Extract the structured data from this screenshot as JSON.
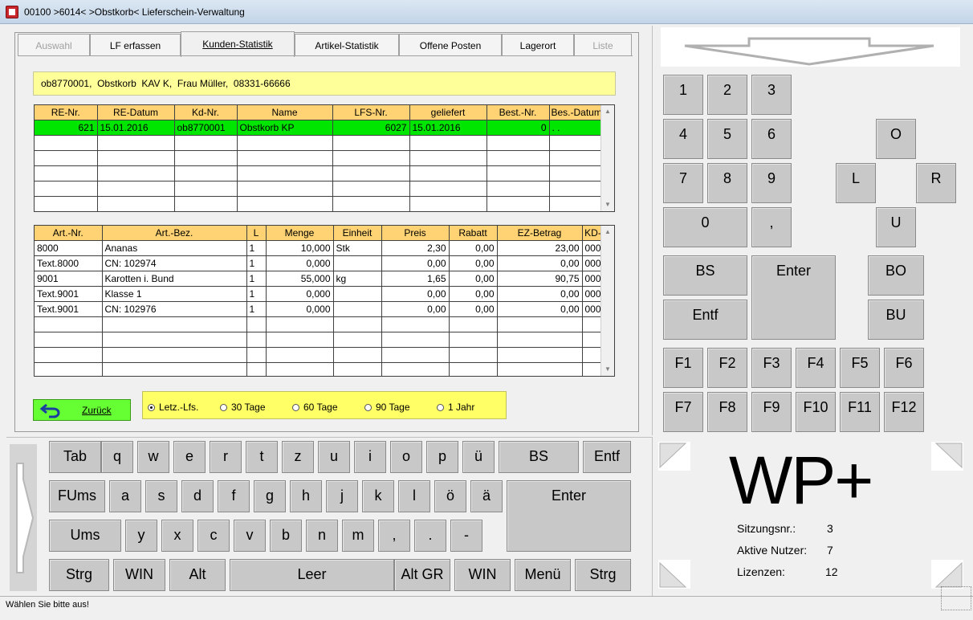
{
  "window": {
    "title": "00100 >6014< >Obstkorb< Lieferschein-Verwaltung"
  },
  "tabs": [
    {
      "label": "Auswahl",
      "state": "disabled"
    },
    {
      "label": "LF erfassen",
      "state": "normal"
    },
    {
      "label": "Kunden-Statistik",
      "state": "active"
    },
    {
      "label": "Artikel-Statistik",
      "state": "normal"
    },
    {
      "label": "Offene Posten",
      "state": "normal"
    },
    {
      "label": "Lagerort",
      "state": "normal"
    },
    {
      "label": "Liste",
      "state": "disabled"
    }
  ],
  "customer": {
    "info": "ob8770001,  Obstkorb  KAV K,  Frau Müller,  08331-66666"
  },
  "invoices": {
    "columns": [
      "RE-Nr.",
      "RE-Datum",
      "Kd-Nr.",
      "Name",
      "LFS-Nr.",
      "geliefert",
      "Best.-Nr.",
      "Bes.-Datum"
    ],
    "rows": [
      [
        "621",
        "15.01.2016",
        "ob8770001",
        "Obstkorb  KP",
        "6027",
        "15.01.2016",
        "0",
        ". ."
      ]
    ]
  },
  "articles": {
    "columns": [
      "Art.-Nr.",
      "Art.-Bez.",
      "L",
      "Menge",
      "Einheit",
      "Preis",
      "Rabatt",
      "EZ-Betrag",
      "KD-"
    ],
    "rows": [
      [
        "8000",
        "Ananas",
        "1",
        "10,000",
        "Stk",
        "2,30",
        "0,00",
        "23,00",
        "000"
      ],
      [
        "Text.8000",
        "CN: 102974",
        "1",
        "0,000",
        "",
        "0,00",
        "0,00",
        "0,00",
        "000"
      ],
      [
        "9001",
        "Karotten i. Bund",
        "1",
        "55,000",
        "kg",
        "1,65",
        "0,00",
        "90,75",
        "000"
      ],
      [
        "Text.9001",
        "Klasse 1",
        "1",
        "0,000",
        "",
        "0,00",
        "0,00",
        "0,00",
        "000"
      ],
      [
        "Text.9001",
        "CN: 102976",
        "1",
        "0,000",
        "",
        "0,00",
        "0,00",
        "0,00",
        "000"
      ]
    ]
  },
  "back_button": {
    "label": "Zurück"
  },
  "period_options": [
    {
      "label": "Letz.-Lfs.",
      "selected": true
    },
    {
      "label": "30 Tage",
      "selected": false
    },
    {
      "label": "60 Tage",
      "selected": false
    },
    {
      "label": "90 Tage",
      "selected": false
    },
    {
      "label": "1 Jahr",
      "selected": false
    }
  ],
  "numpad": {
    "digits": [
      "1",
      "2",
      "3",
      "4",
      "5",
      "6",
      "7",
      "8",
      "9",
      "0",
      ","
    ],
    "nav": {
      "up": "O",
      "left": "L",
      "right": "R",
      "down": "U"
    },
    "bs": "BS",
    "enter": "Enter",
    "entf": "Entf",
    "bo": "BO",
    "bu": "BU",
    "fkeys": [
      "F1",
      "F2",
      "F3",
      "F4",
      "F5",
      "F6",
      "F7",
      "F8",
      "F9",
      "F10",
      "F11",
      "F12"
    ]
  },
  "keyboard": {
    "row1": [
      "Tab",
      "q",
      "w",
      "e",
      "r",
      "t",
      "z",
      "u",
      "i",
      "o",
      "p",
      "ü",
      "BS",
      "Entf"
    ],
    "row2": [
      "FUms",
      "a",
      "s",
      "d",
      "f",
      "g",
      "h",
      "j",
      "k",
      "l",
      "ö",
      "ä",
      "Enter"
    ],
    "row3": [
      "Ums",
      "y",
      "x",
      "c",
      "v",
      "b",
      "n",
      "m",
      ",",
      ".",
      "-"
    ],
    "row4": [
      "Strg",
      "WIN",
      "Alt",
      "Leer",
      "Alt GR",
      "WIN",
      "Menü",
      "Strg"
    ]
  },
  "brand": {
    "logo": "WP+"
  },
  "session": {
    "session_label": "Sitzungsnr.:",
    "session_value": "3",
    "users_label": "Aktive Nutzer:",
    "users_value": "7",
    "licenses_label": "Lizenzen:",
    "licenses_value": "12"
  },
  "status": {
    "text": "Wählen Sie bitte aus!"
  },
  "colors": {
    "selected_row": "#00e600",
    "header": "#ffd373",
    "info_bg": "#ffff99",
    "back_btn": "#66ff33"
  }
}
